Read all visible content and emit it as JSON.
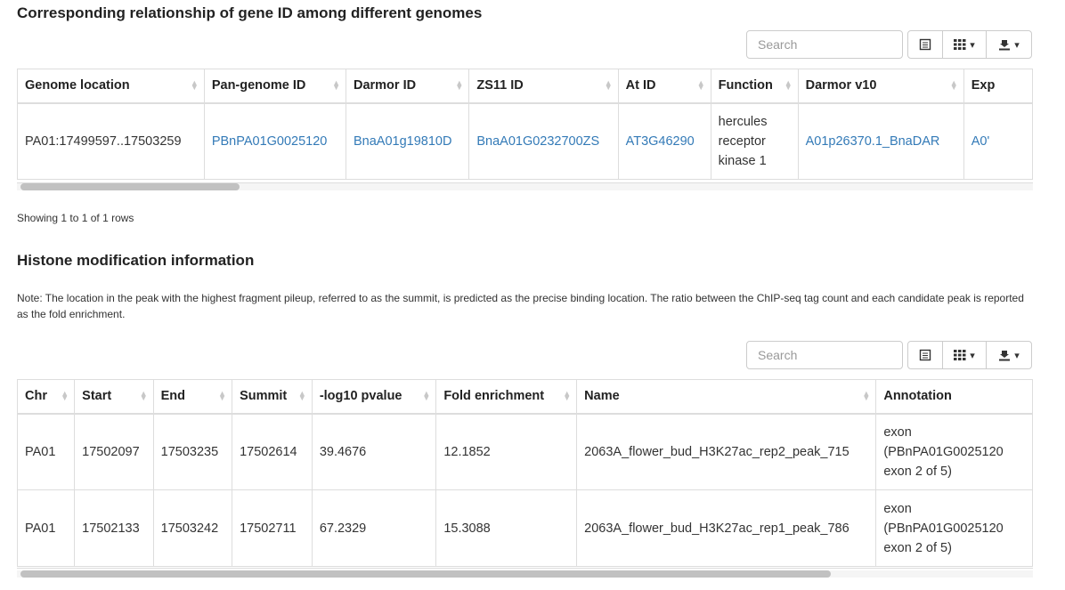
{
  "section1": {
    "title": "Corresponding relationship of gene ID among different genomes",
    "search_placeholder": "Search",
    "columns": [
      "Genome location",
      "Pan-genome ID",
      "Darmor ID",
      "ZS11 ID",
      "At ID",
      "Function",
      "Darmor v10",
      "Exp"
    ],
    "row": {
      "genome_location": "PA01:17499597..17503259",
      "pan_genome_id": "PBnPA01G0025120",
      "darmor_id": "BnaA01g19810D",
      "zs11_id": "BnaA01G0232700ZS",
      "at_id": "AT3G46290",
      "function": "hercules receptor kinase 1",
      "darmor_v10": "A01p26370.1_BnaDAR",
      "exp": "A0'"
    },
    "showing": "Showing 1 to 1 of 1 rows"
  },
  "section2": {
    "title": "Histone modification information",
    "note": "Note: The location in the peak with the highest fragment pileup, referred to as the summit, is predicted as the precise binding location. The ratio between the ChIP-seq tag count and each candidate peak is reported as the fold enrichment.",
    "search_placeholder": "Search",
    "columns": [
      "Chr",
      "Start",
      "End",
      "Summit",
      "-log10 pvalue",
      "Fold enrichment",
      "Name",
      "Annotation"
    ],
    "rows": [
      {
        "chr": "PA01",
        "start": "17502097",
        "end": "17503235",
        "summit": "17502614",
        "pvalue": "39.4676",
        "fold": "12.1852",
        "name": "2063A_flower_bud_H3K27ac_rep2_peak_715",
        "annotation": "exon (PBnPA01G0025120 exon 2 of 5)"
      },
      {
        "chr": "PA01",
        "start": "17502133",
        "end": "17503242",
        "summit": "17502711",
        "pvalue": "67.2329",
        "fold": "15.3088",
        "name": "2063A_flower_bud_H3K27ac_rep1_peak_786",
        "annotation": "exon (PBnPA01G0025120 exon 2 of 5)"
      }
    ]
  },
  "icons": {
    "toggle_view": "list-icon",
    "columns": "grid-icon",
    "export": "download-icon",
    "sort": "sort-both-icon"
  }
}
